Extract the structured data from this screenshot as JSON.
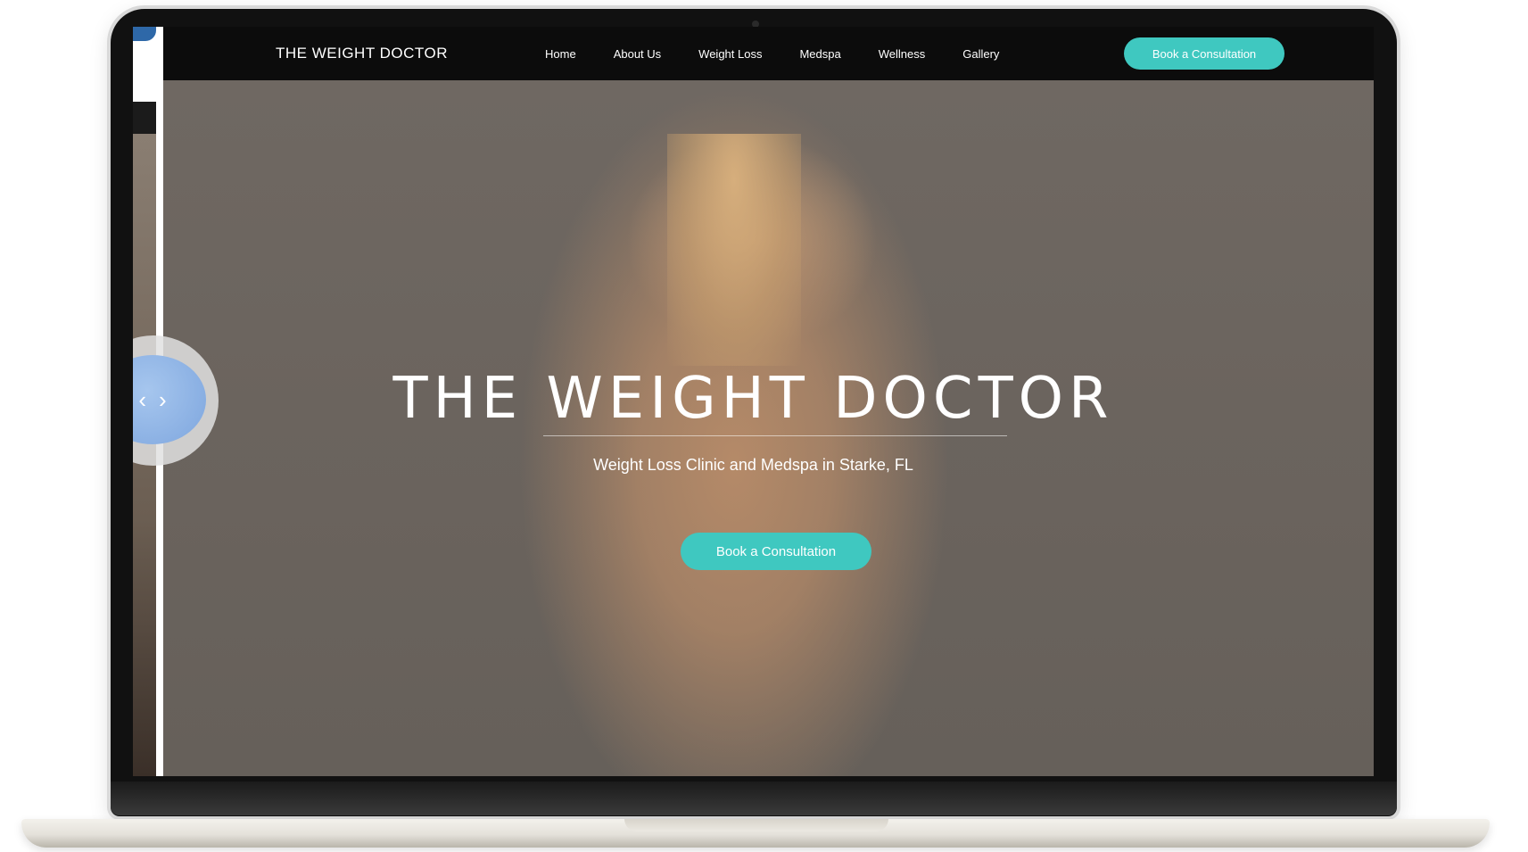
{
  "nav": {
    "logo": "THE WEIGHT DOCTOR",
    "links": [
      "Home",
      "About Us",
      "Weight Loss",
      "Medspa",
      "Wellness",
      "Gallery"
    ],
    "cta_label": "Book a Consultation"
  },
  "hero": {
    "title": "THE WEIGHT DOCTOR",
    "subtitle": "Weight Loss Clinic and Medspa in Starke, FL",
    "cta_label": "Book a Consultation"
  },
  "slider": {
    "left_arrow": "‹",
    "right_arrow": "›"
  },
  "colors": {
    "accent": "#3fc8c0",
    "nav_bg": "#0c0c0c",
    "hero_bg": "#6b6560",
    "slider_knob": "#8fb3e6"
  },
  "icons": [
    "chevron-left-icon",
    "chevron-right-icon"
  ]
}
